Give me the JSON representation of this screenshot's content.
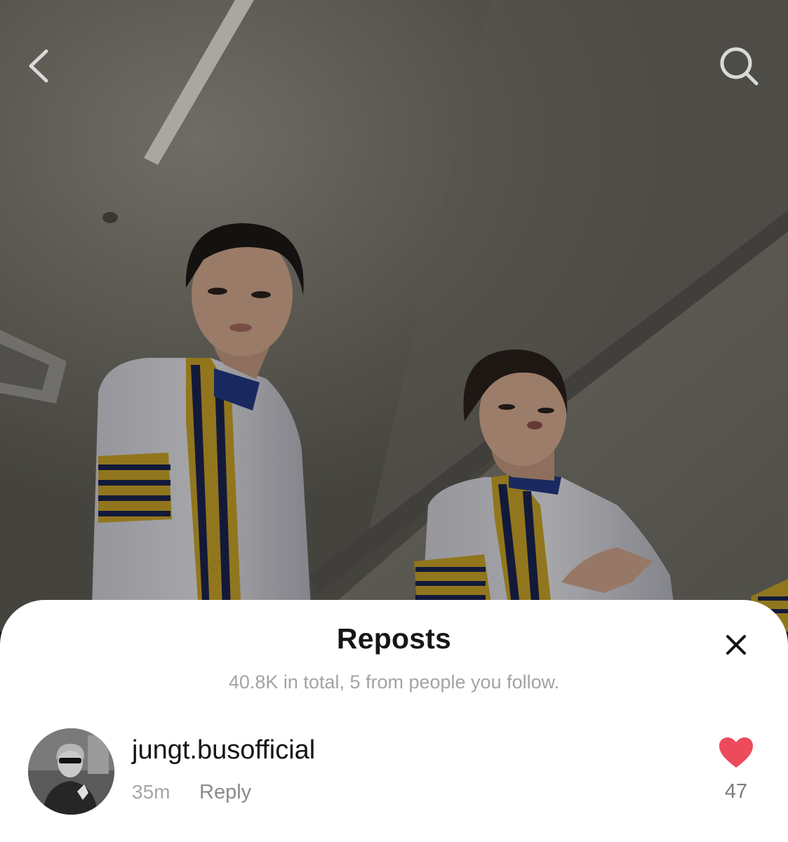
{
  "header": {
    "back_icon": "chevron-left-icon",
    "search_icon": "search-icon"
  },
  "background": {
    "description_colors": {
      "ceiling": "#807d73",
      "uniform": "#d8d8e0",
      "stripe_yellow": "#c9a42a",
      "stripe_navy": "#1b2350"
    }
  },
  "sheet": {
    "title": "Reposts",
    "subtitle": "40.8K in total, 5 from people you follow.",
    "close_icon": "close-icon",
    "items": [
      {
        "username": "jungt.busofficial",
        "time": "35m",
        "reply_label": "Reply",
        "like_count": "47",
        "like_icon": "heart-icon",
        "like_color": "#ee4a5c"
      }
    ]
  }
}
